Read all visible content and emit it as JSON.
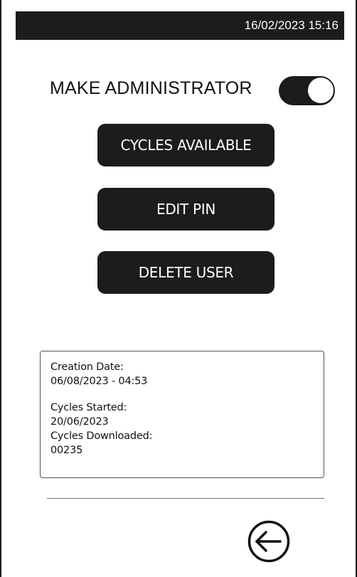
{
  "status_bar": {
    "datetime": "16/02/2023 15:16"
  },
  "admin_toggle": {
    "label": "MAKE ADMINISTRATOR",
    "enabled": true
  },
  "buttons": {
    "cycles_available": "CYCLES AVAILABLE",
    "edit_pin": "EDIT PIN",
    "delete_user": "DELETE USER"
  },
  "info": {
    "creation_date_label": "Creation Date:",
    "creation_date_value": "06/08/2023 - 04:53",
    "cycles_started_label": "Cycles Started:",
    "cycles_started_value": "20/06/2023",
    "cycles_downloaded_label": "Cycles Downloaded:",
    "cycles_downloaded_value": "00235"
  },
  "nav": {
    "back_icon": "arrow-left-circle-icon"
  },
  "colors": {
    "primary": "#1c1c1c",
    "background": "#ffffff",
    "text": "#111111"
  }
}
